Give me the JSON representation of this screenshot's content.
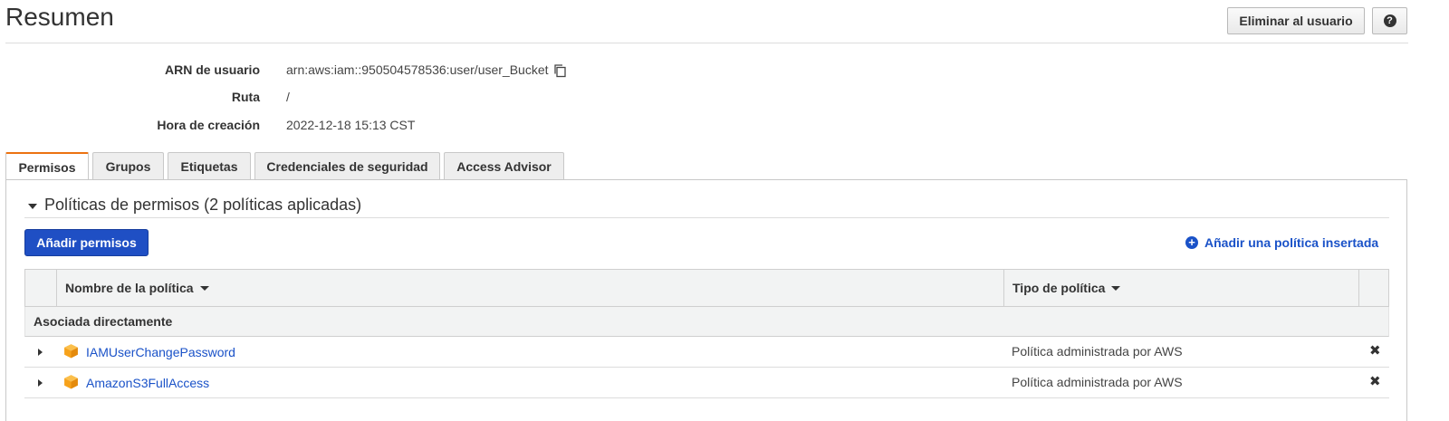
{
  "header": {
    "title": "Resumen",
    "delete_user_label": "Eliminar al usuario",
    "help_icon": "?"
  },
  "summary": {
    "arn_label": "ARN de usuario",
    "arn_value": "arn:aws:iam::950504578536:user/user_Bucket",
    "path_label": "Ruta",
    "path_value": "/",
    "created_label": "Hora de creación",
    "created_value": "2022-12-18 15:13 CST"
  },
  "tabs": [
    {
      "label": "Permisos",
      "active": true
    },
    {
      "label": "Grupos",
      "active": false
    },
    {
      "label": "Etiquetas",
      "active": false
    },
    {
      "label": "Credenciales de seguridad",
      "active": false
    },
    {
      "label": "Access Advisor",
      "active": false
    }
  ],
  "permissions": {
    "section_title": "Políticas de permisos (2 políticas aplicadas)",
    "add_permissions_label": "Añadir permisos",
    "add_inline_policy_label": "Añadir una política insertada",
    "table": {
      "columns": [
        "Nombre de la política",
        "Tipo de política"
      ],
      "group_label": "Asociada directamente",
      "rows": [
        {
          "name": "IAMUserChangePassword",
          "type": "Política administrada por AWS"
        },
        {
          "name": "AmazonS3FullAccess",
          "type": "Política administrada por AWS"
        }
      ]
    }
  },
  "colors": {
    "accent_tab": "#ec7211",
    "primary_button": "#1f4fc4",
    "link": "#1a52c8",
    "policy_icon": "#f7a21b"
  },
  "icons": {
    "copy": "copy-icon",
    "policy": "cube-icon",
    "remove": "✖",
    "plus": "+"
  }
}
